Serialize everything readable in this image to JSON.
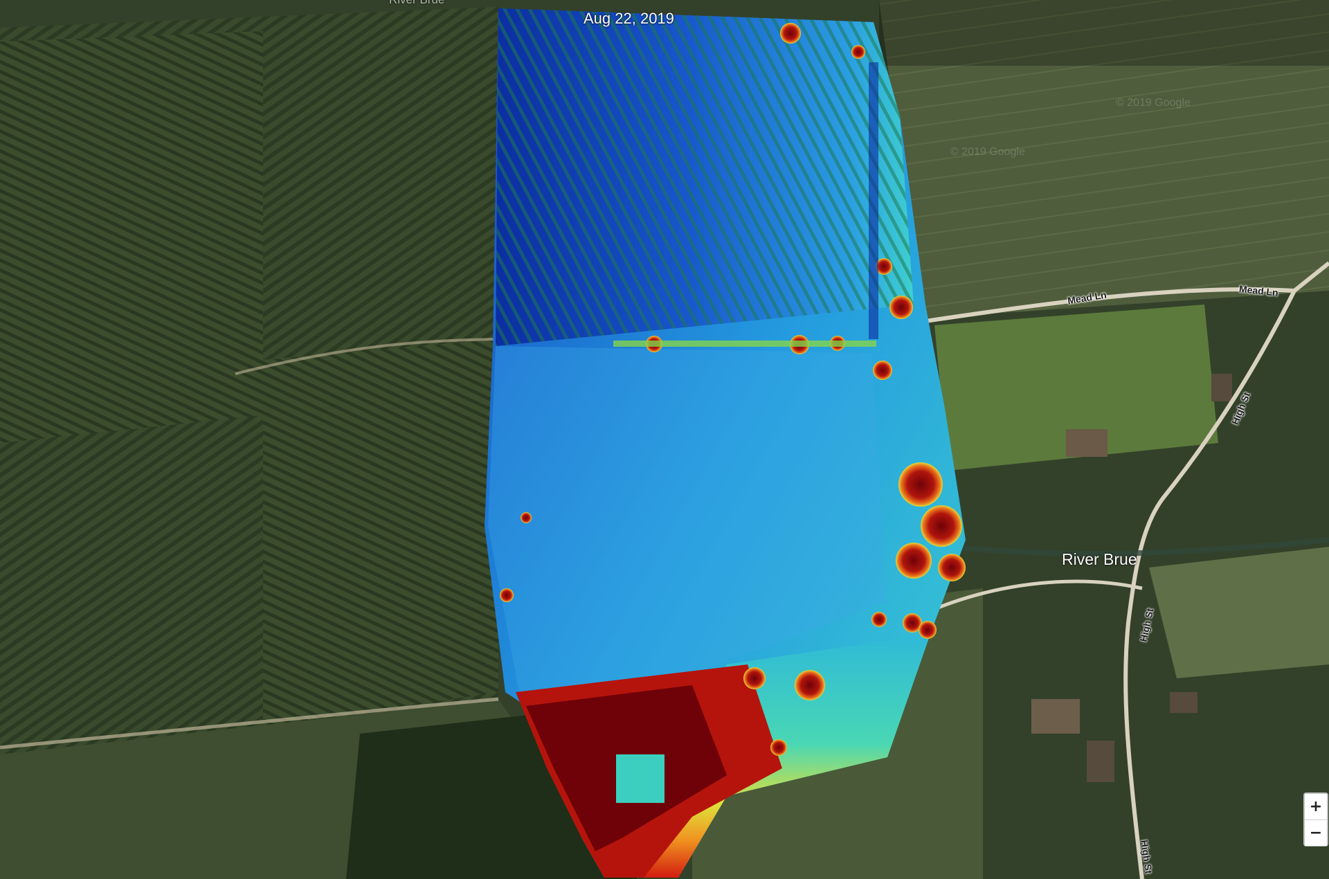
{
  "map": {
    "date_label": "Aug 22, 2019",
    "labels": {
      "river_top": "River Brue",
      "river_mid": "River Brue",
      "road_mead_1": "Mead Ln",
      "road_mead_2": "Mead Ln",
      "road_high_1": "High St",
      "road_high_2": "High St",
      "road_high_3": "High St"
    },
    "watermarks": [
      "© 2019 Google",
      "© 2019 Google"
    ],
    "overlay": {
      "type": "elevation-heatmap",
      "colormap": [
        "#0a2f9e",
        "#1a5fd6",
        "#2aa8e4",
        "#36d1c8",
        "#e3e23a",
        "#f08b1e",
        "#c2140f",
        "#6e0208"
      ]
    }
  },
  "controls": {
    "zoom_in_label": "+",
    "zoom_out_label": "−"
  }
}
